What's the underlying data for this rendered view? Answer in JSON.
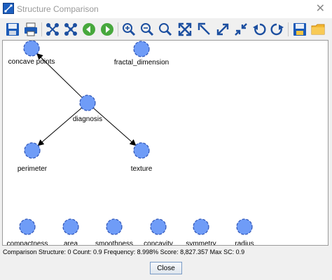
{
  "window": {
    "title": "Structure Comparison",
    "close_glyph": "✕"
  },
  "toolbar": {
    "buttons": [
      {
        "name": "save-icon",
        "tooltip": ""
      },
      {
        "name": "print-icon",
        "tooltip": ""
      },
      {
        "name": "random-layout-icon",
        "tooltip": ""
      },
      {
        "name": "layout-icon",
        "tooltip": ""
      },
      {
        "name": "back-icon",
        "tooltip": ""
      },
      {
        "name": "forward-icon",
        "tooltip": ""
      },
      {
        "name": "zoom-in-icon",
        "tooltip": ""
      },
      {
        "name": "zoom-out-icon",
        "tooltip": ""
      },
      {
        "name": "zoom-icon",
        "tooltip": ""
      },
      {
        "name": "fit-icon",
        "tooltip": ""
      },
      {
        "name": "top-left-icon",
        "tooltip": ""
      },
      {
        "name": "expand-icon",
        "tooltip": ""
      },
      {
        "name": "shrink-icon",
        "tooltip": ""
      },
      {
        "name": "rotate-left-icon",
        "tooltip": ""
      },
      {
        "name": "rotate-right-icon",
        "tooltip": ""
      },
      {
        "name": "save-as-icon",
        "tooltip": ""
      },
      {
        "name": "open-folder-icon",
        "tooltip": ""
      }
    ]
  },
  "graph": {
    "nodes": [
      {
        "id": "concave_points",
        "label": "concave points"
      },
      {
        "id": "fractal_dimension",
        "label": "fractal_dimension"
      },
      {
        "id": "diagnosis",
        "label": "diagnosis"
      },
      {
        "id": "perimeter",
        "label": "perimeter"
      },
      {
        "id": "texture",
        "label": "texture"
      },
      {
        "id": "compactness",
        "label": "compactness"
      },
      {
        "id": "area",
        "label": "area"
      },
      {
        "id": "smoothness",
        "label": "smoothness"
      },
      {
        "id": "concavity",
        "label": "concavity"
      },
      {
        "id": "symmetry",
        "label": "symmetry"
      },
      {
        "id": "radius",
        "label": "radius"
      }
    ],
    "edges": [
      {
        "from": "diagnosis",
        "to": "concave_points"
      },
      {
        "from": "diagnosis",
        "to": "perimeter"
      },
      {
        "from": "diagnosis",
        "to": "texture"
      }
    ],
    "node_fill": "#6f9cf7",
    "node_stroke": "#2f55b7"
  },
  "status": {
    "text": "Comparison Structure: 0 Count: 0.9 Frequency: 8.998% Score: 8,827.357 Max SC: 0.9"
  },
  "footer": {
    "close_label": "Close"
  }
}
